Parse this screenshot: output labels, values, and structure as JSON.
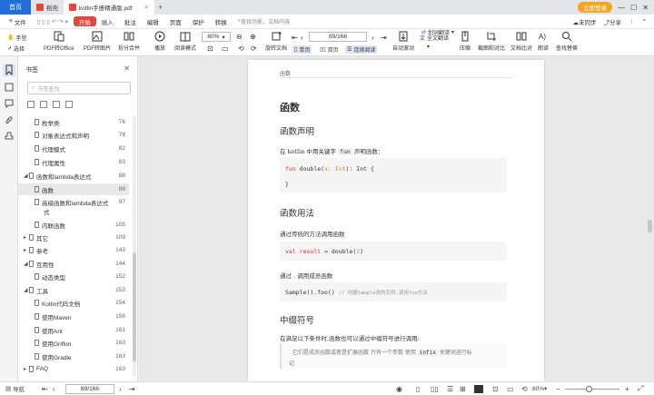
{
  "titlebar": {
    "home": "首页",
    "tab1": "稻壳",
    "tab2": "kotlin手册精通版.pdf",
    "login": "立即登录"
  },
  "menubar": {
    "file": "文件",
    "start": "开始",
    "insert": "插入",
    "annotate": "批注",
    "edit": "编辑",
    "page": "页面",
    "protect": "保护",
    "convert": "转换",
    "search_placeholder": "查找功能、文档内容",
    "cloud": "未同步",
    "share": "分享"
  },
  "toolbar": {
    "hand": "手型",
    "select": "选择",
    "pdf_office": "PDF转Office",
    "pdf_img": "PDF转图片",
    "split": "拆分合并",
    "play": "播放",
    "read_mode": "阅读模式",
    "zoom": "80%",
    "page_current": "89/166",
    "rotate": "旋转文档",
    "single": "单页",
    "double": "双页",
    "continuous": "连续阅读",
    "auto_scroll": "自动滚动",
    "full_translate": "全文翻译",
    "translate": "划词翻译",
    "compress": "压缩",
    "screenshot": "截图和对比",
    "compare": "文档比对",
    "read_aloud": "朗读",
    "find_replace": "查找替换"
  },
  "panel": {
    "title": "书签",
    "search_placeholder": "书签查找",
    "items": [
      {
        "label": "枚举类",
        "page": "76",
        "level": 2
      },
      {
        "label": "对象表达式和声明",
        "page": "78",
        "level": 2
      },
      {
        "label": "代理模式",
        "page": "82",
        "level": 2
      },
      {
        "label": "代理属性",
        "page": "83",
        "level": 2
      },
      {
        "label": "函数和lambda表达式",
        "page": "88",
        "level": 1
      },
      {
        "label": "函数",
        "page": "89",
        "level": 2
      },
      {
        "label": "高级函数和lambda表达式",
        "label2": "式",
        "page": "97",
        "level": 2
      },
      {
        "label": "内联函数",
        "page": "105",
        "level": 2
      },
      {
        "label": "其它",
        "page": "109",
        "level": 1
      },
      {
        "label": "参考",
        "page": "143",
        "level": 1
      },
      {
        "label": "互用性",
        "page": "144",
        "level": 1
      },
      {
        "label": "动态类型",
        "page": "152",
        "level": 2
      },
      {
        "label": "工具",
        "page": "153",
        "level": 1
      },
      {
        "label": "Kotlin代码文档",
        "page": "154",
        "level": 2
      },
      {
        "label": "使用Maven",
        "page": "156",
        "level": 2
      },
      {
        "label": "使用Ant",
        "page": "161",
        "level": 2
      },
      {
        "label": "使用Griffon",
        "page": "163",
        "level": 2
      },
      {
        "label": "使用Gradle",
        "page": "163",
        "level": 2
      },
      {
        "label": "FAQ",
        "page": "163",
        "level": 1
      }
    ]
  },
  "doc": {
    "header": "函数",
    "h1": "函数",
    "h2a": "函数声明",
    "p1a": "在 kotlin 中用关键字",
    "p1kw": "fun",
    "p1b": "声明函数：",
    "code1a": "fun double(x: Int): Int {",
    "code1b": "}",
    "h2b": "函数用法",
    "p2": "通过传统的方法调用函数",
    "code2": "val result = double(2)",
    "p3": "通过 . 调用成员函数",
    "code3a": "Sample().foo()",
    "code3b": "// 创建Sample类的实例,调用foo方法",
    "h2c": "中缀符号",
    "p4": "在满足以下条件时,函数也可以通过中缀符号进行调用:",
    "q1": "它们是成员函数或者是扩展函数",
    "q2": "只有一个参数 使用",
    "q3": "infix",
    "q4": "关键词进行标",
    "q5": "记"
  },
  "statusbar": {
    "nav": "导航",
    "page": "89/166",
    "zoom": "80%"
  },
  "colors": {
    "accent": "#1e6fd9",
    "start": "#e8463a",
    "keyword": "#c0392b",
    "number": "#e67e22"
  }
}
